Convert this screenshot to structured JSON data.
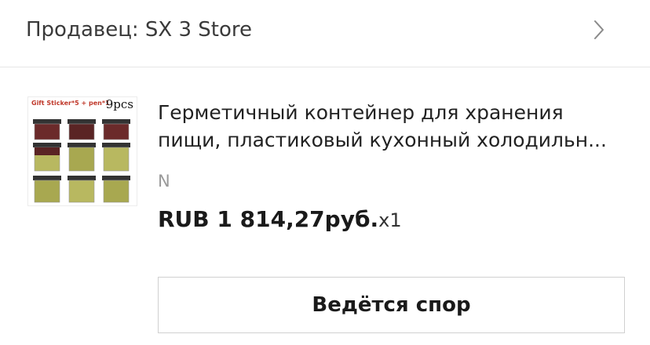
{
  "seller": {
    "label": "Продавец: SX 3 Store",
    "chevron_icon": "chevron-right-icon"
  },
  "product": {
    "thumbnail": {
      "caption": "Gift Sticker*5 + pen*1",
      "badge": "9pcs"
    },
    "title_line_1": "Герметичный контейнер для хранения",
    "title_line_2": "пищи, пластиковый кухонный холодильн...",
    "variant": "N",
    "price": "RUB 1 814,27руб.",
    "quantity": "x1"
  },
  "actions": {
    "dispute_label": "Ведётся спор"
  },
  "colors": {
    "text_primary": "#222222",
    "text_muted": "#9a9a9a",
    "divider": "#e6e6e6",
    "button_border": "#d0d0d0"
  }
}
